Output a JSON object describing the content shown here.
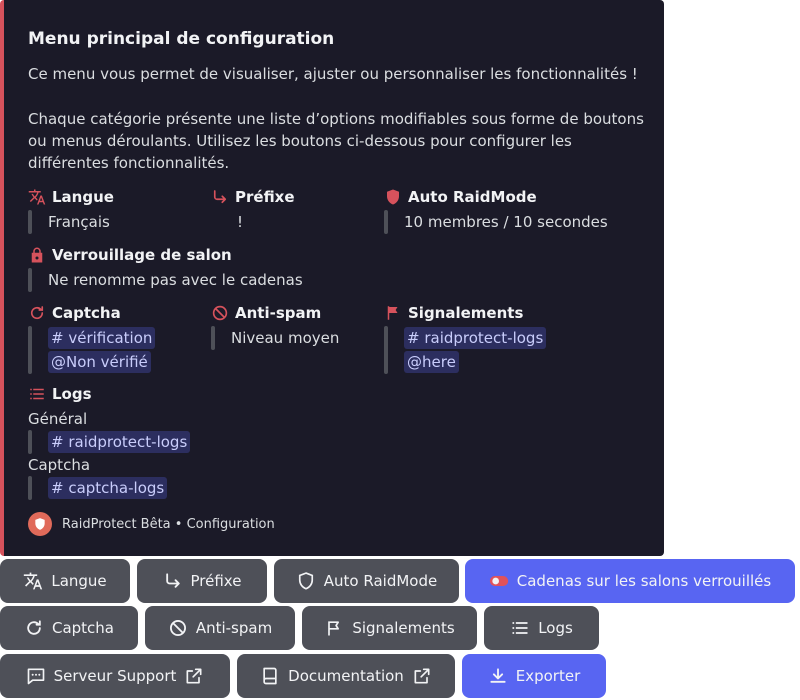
{
  "embed": {
    "title": "Menu principal de configuration",
    "desc1": "Ce menu vous permet de visualiser, ajuster ou personnaliser les fonctionnalités !",
    "desc2": "Chaque catégorie présente une liste d’options modifiables sous forme de boutons ou menus déroulants. Utilisez les boutons ci-dessous pour configurer les différentes fonctionnalités.",
    "accent_color": "#d6525c",
    "fields": {
      "langue": {
        "name": "Langue",
        "value": "Français"
      },
      "prefixe": {
        "name": "Préfixe",
        "value": "!"
      },
      "raidmode": {
        "name": "Auto RaidMode",
        "value": "10 membres / 10 secondes"
      },
      "verrouillage": {
        "name": "Verrouillage de salon",
        "value": "Ne renomme pas avec le cadenas"
      },
      "captcha": {
        "name": "Captcha",
        "channel": "# vérification",
        "role": "@Non vérifié"
      },
      "antispam": {
        "name": "Anti-spam",
        "value": "Niveau moyen"
      },
      "signalements": {
        "name": "Signalements",
        "channel": "# raidprotect-logs",
        "role": "@here"
      },
      "logs": {
        "name": "Logs",
        "general_label": "Général",
        "general_channel": "# raidprotect-logs",
        "captcha_label": "Captcha",
        "captcha_channel": "# captcha-logs"
      }
    },
    "footer": "RaidProtect Bêta • Configuration"
  },
  "buttons": {
    "langue": "Langue",
    "prefixe": "Préfixe",
    "raidmode": "Auto RaidMode",
    "cadenas": "Cadenas sur les salons verrouillés",
    "captcha": "Captcha",
    "antispam": "Anti-spam",
    "signalements": "Signalements",
    "logs": "Logs",
    "support": "Serveur Support",
    "documentation": "Documentation",
    "exporter": "Exporter"
  },
  "colors": {
    "primary_button": "#5865f2",
    "secondary_button": "#4e5058",
    "embed_bg": "#1b1a28"
  }
}
